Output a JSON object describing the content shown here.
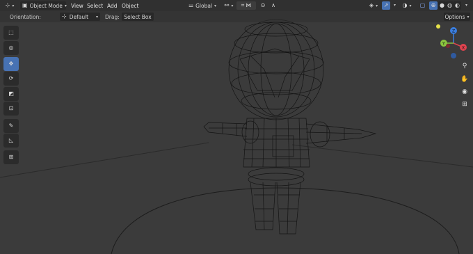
{
  "header": {
    "mode": "Object Mode",
    "menus": [
      "View",
      "Select",
      "Add",
      "Object"
    ],
    "transform_orientation": "Global",
    "options_label": "Options"
  },
  "tool_settings": {
    "orientation_label": "Orientation:",
    "orientation_value": "Default",
    "drag_label": "Drag:",
    "drag_value": "Select Box"
  },
  "toolbar": {
    "tools": [
      "select-box",
      "cursor",
      "move",
      "rotate",
      "scale",
      "transform",
      "annotate",
      "measure",
      "add-cube"
    ],
    "active_tool": "move"
  },
  "gizmo": {
    "axes": [
      {
        "label": "Y",
        "color": "#8bc43f"
      },
      {
        "label": "X",
        "color": "#e0434f"
      },
      {
        "label": "Z",
        "color": "#3a7ee0"
      }
    ],
    "light_color": "#e6e14a"
  },
  "colors": {
    "viewport_bg": "#3b3b3b",
    "header_bg": "#303030",
    "active_blue": "#4772b3",
    "wire": "#0d0d0d"
  }
}
